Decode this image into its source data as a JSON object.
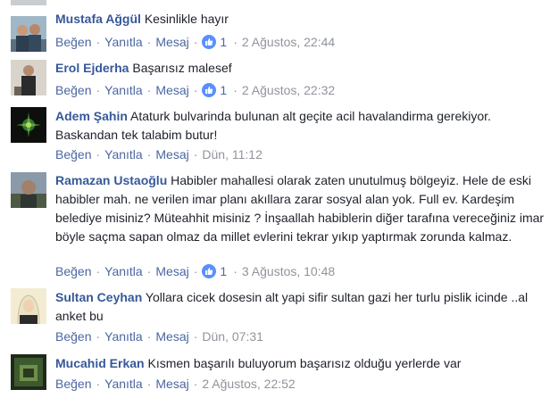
{
  "comments": [
    {
      "author": "Mustafa Ağgül",
      "text": "Kesinlikle hayır",
      "like_label": "Beğen",
      "reply_label": "Yanıtla",
      "message_label": "Mesaj",
      "likes": "1",
      "time": "2 Ağustos, 22:44"
    },
    {
      "author": "Erol Ejderha",
      "text": "Başarısız malesef",
      "like_label": "Beğen",
      "reply_label": "Yanıtla",
      "message_label": "Mesaj",
      "likes": "1",
      "time": "2 Ağustos, 22:32"
    },
    {
      "author": "Adem Şahin",
      "text": "Ataturk bulvarinda bulunan alt geçite acil havalandirma gerekiyor. Baskandan tek talabim butur!",
      "like_label": "Beğen",
      "reply_label": "Yanıtla",
      "message_label": "Mesaj",
      "likes": "",
      "time": "Dün, 11:12"
    },
    {
      "author": "Ramazan Ustaoğlu",
      "text": "Habibler mahallesi olarak zaten unutulmuş bölgeyiz. Hele de eski habibler mah. ne verilen imar planı akıllara zarar sosyal alan yok. Full ev. Kardeşim belediye misiniz? Müteahhit misiniz ? İnşaallah habiblerin diğer tarafına vereceğiniz imar böyle saçma sapan olmaz da millet evlerini tekrar yıkıp yaptırmak zorunda kalmaz.",
      "like_label": "Beğen",
      "reply_label": "Yanıtla",
      "message_label": "Mesaj",
      "likes": "1",
      "time": "3 Ağustos, 10:48"
    },
    {
      "author": "Sultan Ceyhan",
      "text": "Yollara cicek dosesin alt yapi sifir sultan gazi her turlu pislik icinde ..al anket bu",
      "like_label": "Beğen",
      "reply_label": "Yanıtla",
      "message_label": "Mesaj",
      "likes": "",
      "time": "Dün, 07:31"
    },
    {
      "author": "Mucahid Erkan",
      "text": "Kısmen başarılı buluyorum başarısız olduğu yerlerde var",
      "like_label": "Beğen",
      "reply_label": "Yanıtla",
      "message_label": "Mesaj",
      "likes": "",
      "time": "2 Ağustos, 22:52"
    }
  ],
  "colors": {
    "author": "#365899",
    "link": "#4b67a1",
    "meta": "#90949c",
    "like_badge": "#5890ff"
  },
  "icons": {
    "like": "thumbs-up-icon"
  }
}
